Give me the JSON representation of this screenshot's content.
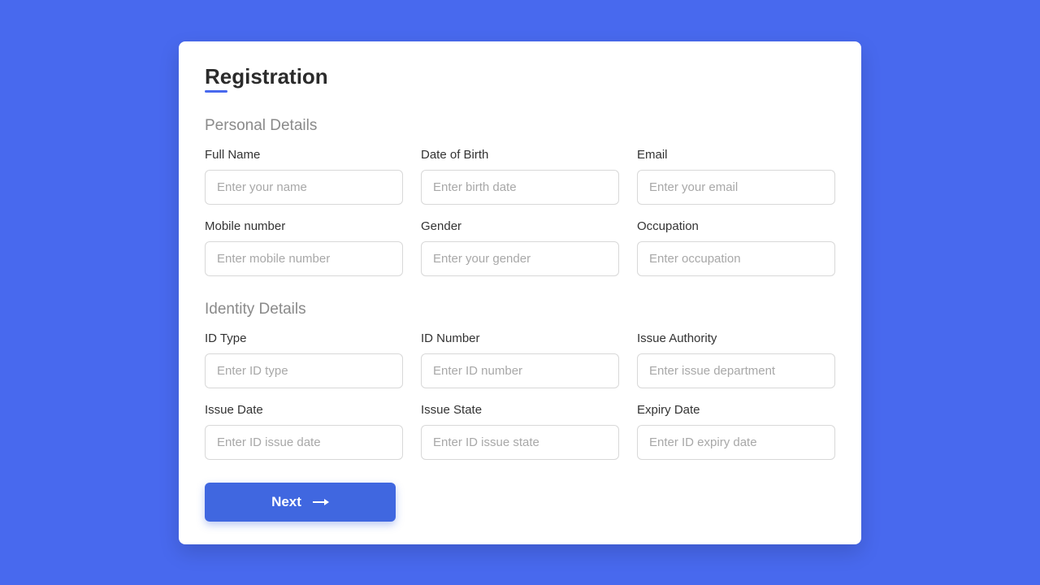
{
  "title": "Registration",
  "sections": {
    "personal": {
      "title": "Personal Details",
      "fields": {
        "full_name": {
          "label": "Full Name",
          "placeholder": "Enter your name"
        },
        "dob": {
          "label": "Date of Birth",
          "placeholder": "Enter birth date"
        },
        "email": {
          "label": "Email",
          "placeholder": "Enter your email"
        },
        "mobile": {
          "label": "Mobile number",
          "placeholder": "Enter mobile number"
        },
        "gender": {
          "label": "Gender",
          "placeholder": "Enter your gender"
        },
        "occupation": {
          "label": "Occupation",
          "placeholder": "Enter occupation"
        }
      }
    },
    "identity": {
      "title": "Identity Details",
      "fields": {
        "id_type": {
          "label": "ID Type",
          "placeholder": "Enter ID type"
        },
        "id_number": {
          "label": "ID Number",
          "placeholder": "Enter ID number"
        },
        "issue_authority": {
          "label": "Issue Authority",
          "placeholder": "Enter issue department"
        },
        "issue_date": {
          "label": "Issue Date",
          "placeholder": "Enter ID issue date"
        },
        "issue_state": {
          "label": "Issue State",
          "placeholder": "Enter ID issue state"
        },
        "expiry_date": {
          "label": "Expiry Date",
          "placeholder": "Enter ID expiry date"
        }
      }
    }
  },
  "next_button": "Next"
}
